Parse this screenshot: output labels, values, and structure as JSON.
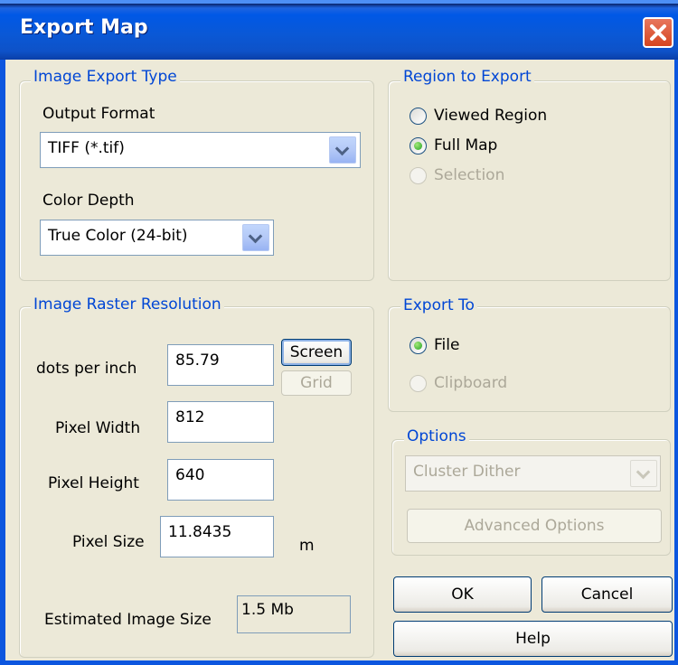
{
  "window": {
    "title": "Export Map"
  },
  "image_export_type": {
    "legend": "Image Export Type",
    "output_format_label": "Output Format",
    "output_format_value": "TIFF (*.tif)",
    "color_depth_label": "Color Depth",
    "color_depth_value": "True Color (24-bit)"
  },
  "region": {
    "legend": "Region to Export",
    "options": [
      {
        "label": "Viewed Region",
        "checked": false,
        "enabled": true
      },
      {
        "label": "Full Map",
        "checked": true,
        "enabled": true
      },
      {
        "label": "Selection",
        "checked": false,
        "enabled": false
      }
    ]
  },
  "raster": {
    "legend": "Image Raster Resolution",
    "dpi_label": "dots per inch",
    "dpi_value": "85.79",
    "screen_button": "Screen",
    "grid_button": "Grid",
    "width_label": "Pixel Width",
    "width_value": "812",
    "height_label": "Pixel Height",
    "height_value": "640",
    "size_label": "Pixel Size",
    "size_value": "11.8435",
    "size_unit": "m",
    "estimate_label": "Estimated Image Size",
    "estimate_value": "1.5 Mb"
  },
  "export_to": {
    "legend": "Export To",
    "options": [
      {
        "label": "File",
        "checked": true,
        "enabled": true
      },
      {
        "label": "Clipboard",
        "checked": false,
        "enabled": false
      }
    ]
  },
  "options": {
    "legend": "Options",
    "dither_value": "Cluster Dither",
    "advanced_button": "Advanced Options"
  },
  "buttons": {
    "ok": "OK",
    "cancel": "Cancel",
    "help": "Help"
  },
  "colors": {
    "titlebar": "#0058e6",
    "legend": "#0046d5",
    "window_bg": "#ece9d8",
    "close": "#d54520"
  },
  "icons": {
    "close": "close-icon",
    "dropdown": "chevron-down-icon"
  }
}
